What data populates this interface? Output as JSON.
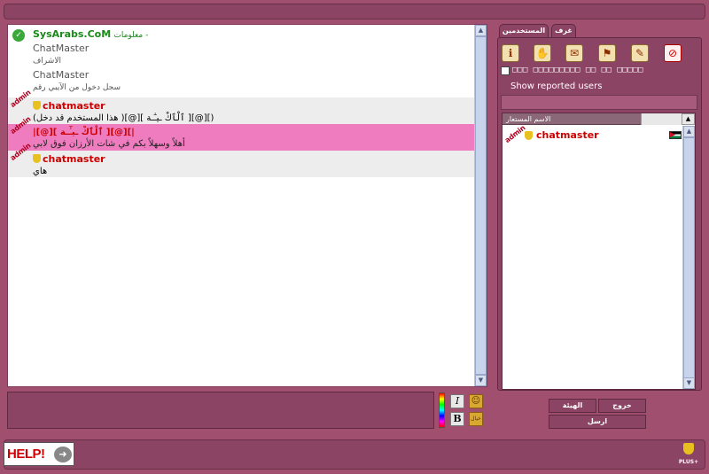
{
  "chat": {
    "messages": [
      {
        "kind": "info",
        "site": "SysArabs.CoM",
        "header_prefix": "معلومات - ",
        "lines": [
          "ChatMaster",
          "الاشراف",
          "ChatMaster",
          "سجل دخول من الآيبي رقم"
        ]
      },
      {
        "kind": "grey",
        "admin": "admin",
        "user": "chatmaster",
        "text": "(هذا المستخدم قد دخل )[@][ ٱلْٱكْ ـيـٰٓـة ][@][)"
      },
      {
        "kind": "pink",
        "admin": "admin",
        "user": "|[@][ ٱلْٱكْ ـيـٰٓـة ][@][|",
        "text": "أهلاً وسهلاً بكم في شات الأرزان فوق لابي"
      },
      {
        "kind": "grey2",
        "admin": "admin",
        "user": "chatmaster",
        "text": "هاي"
      }
    ]
  },
  "format": {
    "italic": "I",
    "bold": "B",
    "smiley": "☺",
    "emoji2": "خيال"
  },
  "tabs": {
    "users": "المستخدمين",
    "rooms": "غرف"
  },
  "tools": [
    "info",
    "ignore",
    "private",
    "kick",
    "edit",
    "ban"
  ],
  "filter": {
    "boxes": "□□□ □□□□□□□□□ □□ □□ □□□□□"
  },
  "reported": "Show reported users",
  "users": {
    "header": "الاسم المستعار",
    "sort": "▲",
    "rows": [
      {
        "admin": "admin",
        "name": "chatmaster"
      }
    ]
  },
  "actions": {
    "status": "الهيئة",
    "exit": "خروج",
    "send": "ارسل"
  },
  "help": {
    "label": "HELP!",
    "arrow": "➜"
  },
  "plus": "PLUS+"
}
